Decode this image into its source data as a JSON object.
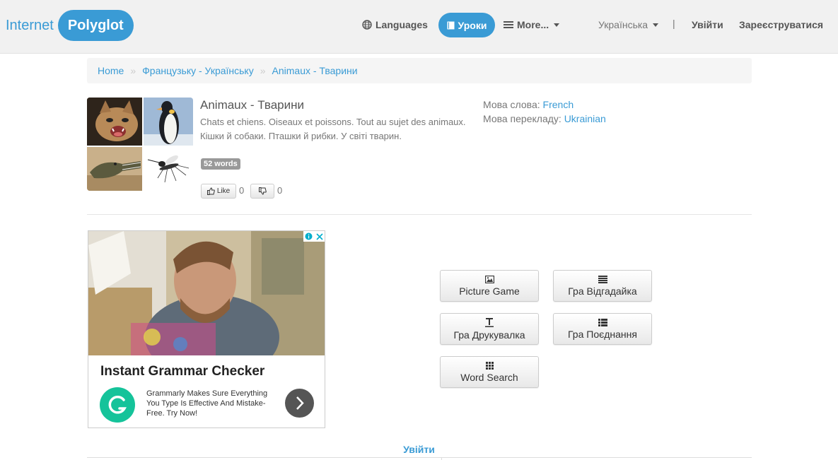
{
  "navbar": {
    "brand_left": "Internet",
    "brand_right": "Polyglot",
    "languages": "Languages",
    "lessons": "Уроки",
    "more": "More...",
    "ui_language": "Українська",
    "separator": "|",
    "login": "Увійти",
    "register": "Зареєструватися"
  },
  "breadcrumb": {
    "items": [
      "Home",
      "Французьку - Українську",
      "Animaux - Тварини"
    ],
    "separator": "»"
  },
  "lesson": {
    "title": "Animaux - Тварини",
    "description": "Chats et chiens. Oiseaux et poissons. Tout au sujet des animaux. Кішки й собаки. Пташки й рибки. У світі тварин.",
    "badge": "52 words",
    "like_label": "Like",
    "like_count": "0",
    "dislike_count": "0",
    "word_language_label": "Мова слова:",
    "word_language": "French",
    "translation_language_label": "Мова перекладу:",
    "translation_language": "Ukrainian"
  },
  "ad": {
    "title": "Instant Grammar Checker",
    "text": "Grammarly Makes Sure Everything You Type Is Effective And Mistake-Free. Try Now!"
  },
  "games": {
    "picture": "Picture Game",
    "guess": "Гра Відгадайка",
    "typing": "Гра Друкувалка",
    "match": "Гра Поєднання",
    "word_search": "Word Search"
  },
  "footer": {
    "login": "Увійти"
  },
  "colors": {
    "accent": "#3a9bd5",
    "navbar_bg": "#f1f1f1",
    "badge_bg": "#999999",
    "grammarly": "#15c39a"
  }
}
